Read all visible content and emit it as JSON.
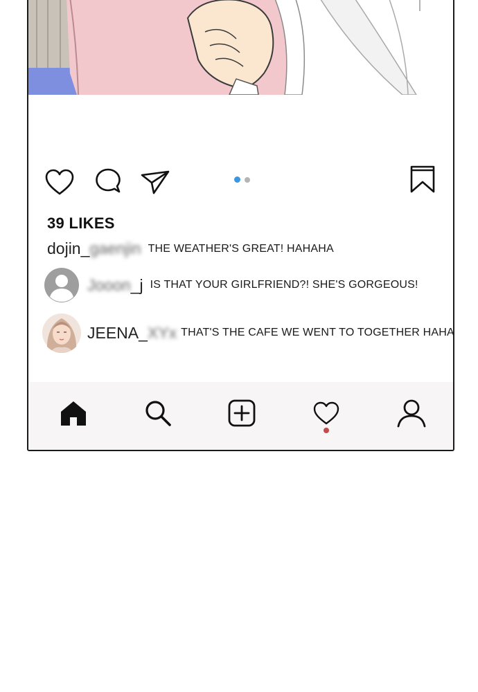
{
  "post": {
    "likes": "39 LIKES",
    "caption": {
      "username_visible": "dojin_",
      "username_blurred": "gaenjin",
      "text": "THE WEATHER'S GREAT! HAHAHA"
    },
    "comments": [
      {
        "username_blurred": "Jooon",
        "username_visible": "_j",
        "text": "IS THAT YOUR GIRLFRIEND?! SHE'S GORGEOUS!",
        "avatar": "default-avatar-icon"
      },
      {
        "username_visible": "JEENA_",
        "username_blurred": "XYx",
        "text": "THAT'S THE CAFE WE WENT TO TOGETHER HAHA",
        "avatar": "illustrated-woman-avatar"
      }
    ],
    "carousel": {
      "count": 2,
      "active": 1
    }
  },
  "actions": [
    "heart-icon",
    "comment-icon",
    "share-icon",
    "bookmark-icon"
  ],
  "nav": [
    "home-icon",
    "search-icon",
    "add-post-icon",
    "activity-heart-icon",
    "profile-icon"
  ],
  "colors": {
    "active_dot": "#3d97e0",
    "inactive_dot": "#b5b5b5",
    "notification_dot": "#c24a4a",
    "navbar_bg": "#f7f5f5"
  }
}
